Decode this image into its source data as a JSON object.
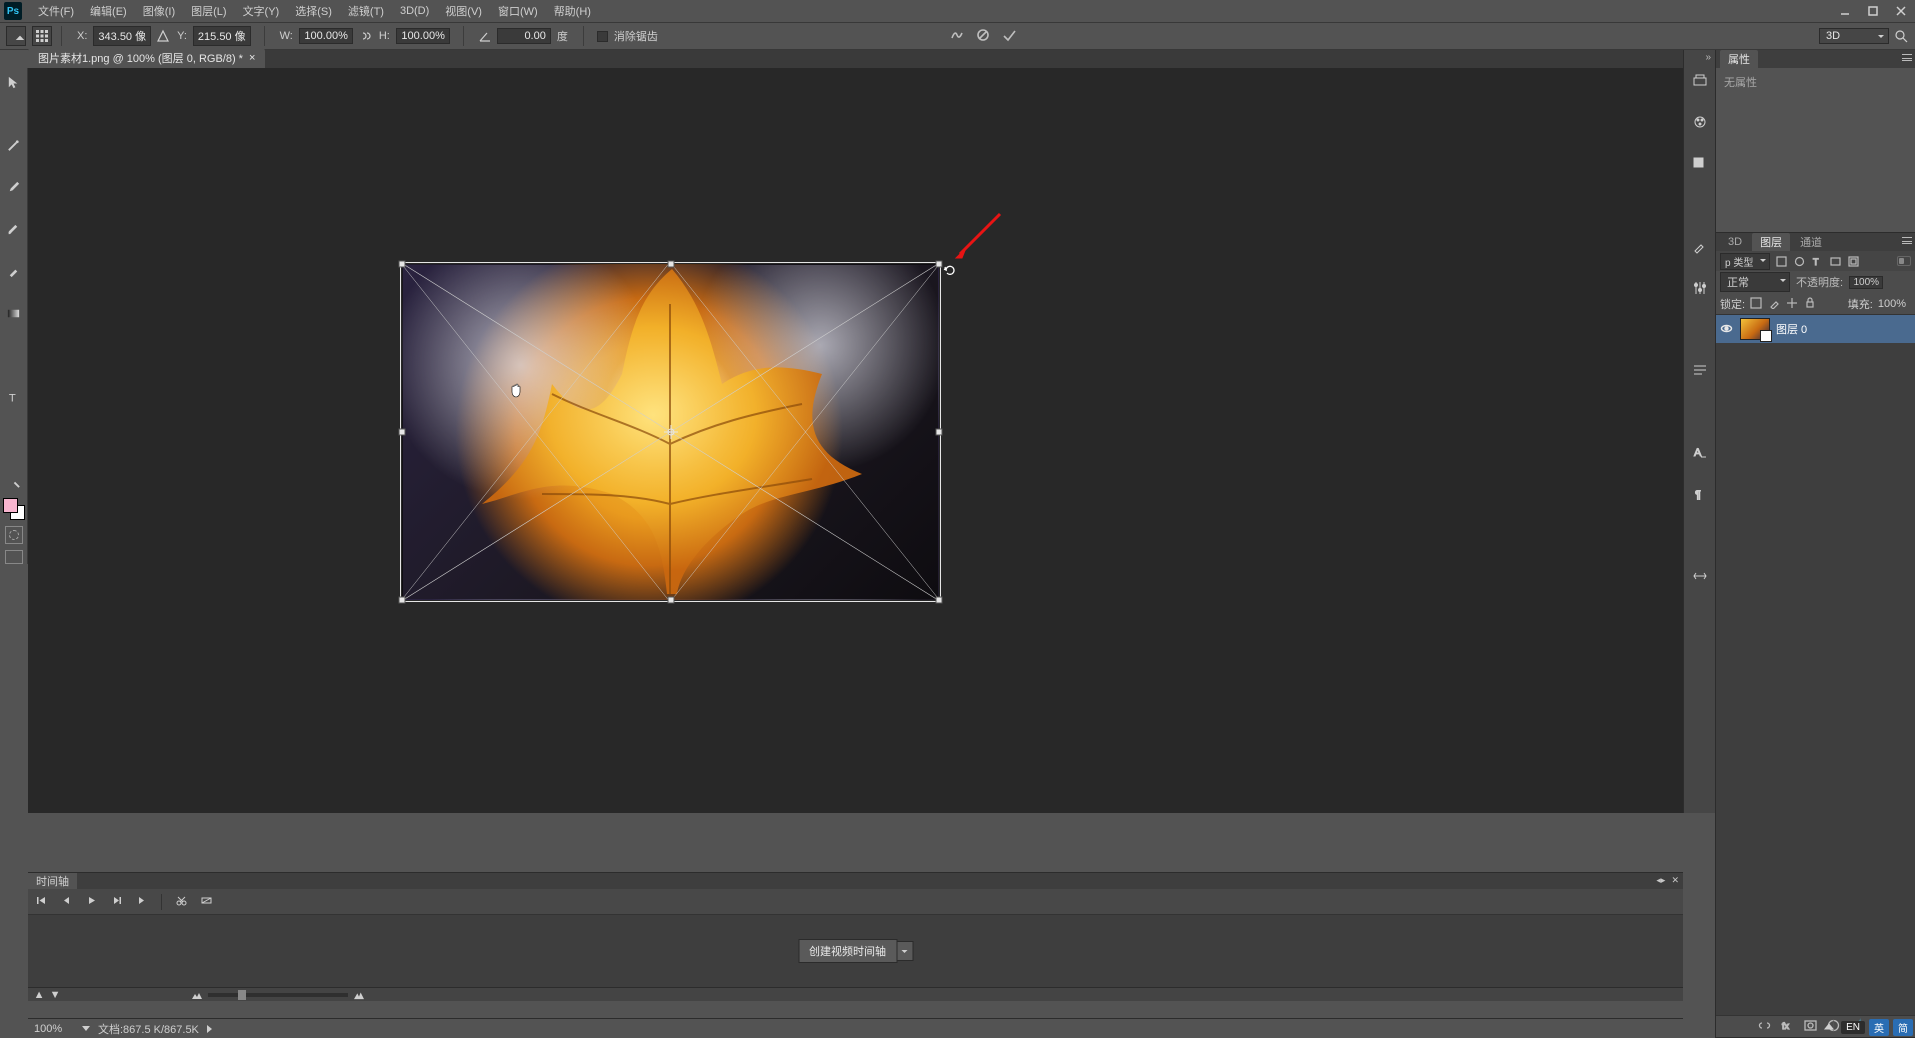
{
  "menu": {
    "items": [
      "文件(F)",
      "编辑(E)",
      "图像(I)",
      "图层(L)",
      "文字(Y)",
      "选择(S)",
      "滤镜(T)",
      "3D(D)",
      "视图(V)",
      "窗口(W)",
      "帮助(H)"
    ]
  },
  "window_controls": {
    "min": "–",
    "max": "❐",
    "close": "✕"
  },
  "options": {
    "x_label": "X:",
    "x_value": "343.50 像",
    "y_label": "Y:",
    "y_value": "215.50 像",
    "w_label": "W:",
    "w_value": "100.00%",
    "h_label": "H:",
    "h_value": "100.00%",
    "angle_value": "0.00",
    "angle_unit": "度",
    "antialias": "消除锯齿",
    "workspace_3d": "3D"
  },
  "document": {
    "tab_title": "图片素材1.png @ 100% (图层 0, RGB/8) *"
  },
  "tools": [
    "move-tool",
    "rect-marquee-tool",
    "lasso-tool",
    "magic-wand-tool",
    "crop-tool",
    "eyedropper-tool",
    "spot-heal-tool",
    "brush-tool",
    "clone-stamp-tool",
    "history-brush-tool",
    "eraser-tool",
    "gradient-tool",
    "blur-tool",
    "dodge-tool",
    "pen-tool",
    "type-tool",
    "path-select-tool",
    "rectangle-shape-tool",
    "hand-tool",
    "zoom-tool"
  ],
  "right_strip_icons": [
    "history-icon",
    "actions-icon",
    "styles-icon",
    "adjustments-icon",
    "swatches-icon",
    "brushes-icon",
    "character-icon",
    "paragraph-icon",
    "clone-source-icon"
  ],
  "properties_panel": {
    "tab": "属性",
    "body": "无属性"
  },
  "layers_panel": {
    "tabs": [
      "3D",
      "图层",
      "通道"
    ],
    "active_tab": 1,
    "filter_kind": "p 类型",
    "blend_mode": "正常",
    "opacity_label": "不透明度:",
    "opacity_value": "100%",
    "lock_label": "锁定:",
    "fill_label": "填充:",
    "fill_value": "100%",
    "layers": [
      {
        "name": "图层 0",
        "visible": true
      }
    ]
  },
  "timeline": {
    "tab": "时间轴",
    "create_button": "创建视频时间轴"
  },
  "status": {
    "zoom": "100%",
    "doc_info": "文档:867.5 K/867.5K"
  },
  "tray": {
    "ime1": "EN",
    "ime2": "英",
    "ime3": "简"
  }
}
